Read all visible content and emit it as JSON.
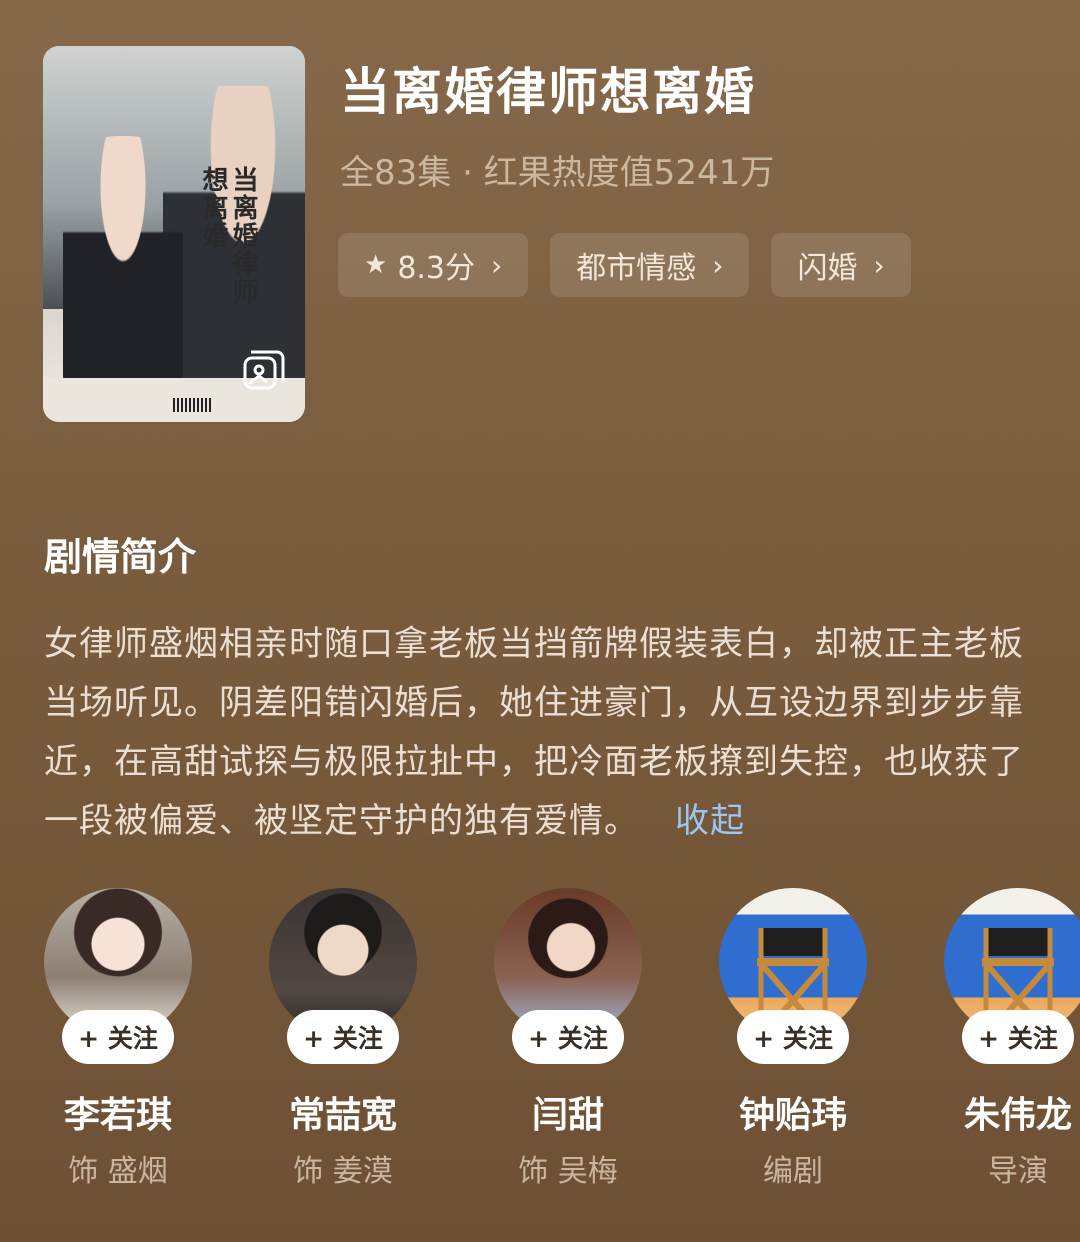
{
  "drama": {
    "title": "当离婚律师想离婚",
    "meta": "全83集 · 红果热度值5241万",
    "poster_title_art": "当离婚律师想离婚"
  },
  "chips": [
    {
      "label": "8.3分",
      "icon": "star-icon",
      "chevron": "›"
    },
    {
      "label": "都市情感",
      "chevron": "›"
    },
    {
      "label": "闪婚",
      "chevron": "›"
    }
  ],
  "synopsis": {
    "heading": "剧情简介",
    "text": "女律师盛烟相亲时随口拿老板当挡箭牌假装表白，却被正主老板当场听见。阴差阳错闪婚后，她住进豪门，从互设边界到步步靠近，在高甜试探与极限拉扯中，把冷面老板撩到失控，也收获了一段被偏爱、被坚定守护的独有爱情。",
    "collapse_label": "收起"
  },
  "cast": [
    {
      "name": "李若琪",
      "role": "饰 盛烟",
      "follow": "+ 关注",
      "avatar": "woman-avatar"
    },
    {
      "name": "常喆宽",
      "role": "饰 姜漠",
      "follow": "+ 关注",
      "avatar": "man-avatar"
    },
    {
      "name": "闫甜",
      "role": "饰 吴梅",
      "follow": "+ 关注",
      "avatar": "woman-avatar"
    },
    {
      "name": "钟贻玮",
      "role": "编剧",
      "follow": "+ 关注",
      "avatar": "director-chair-avatar"
    },
    {
      "name": "朱伟龙",
      "role": "导演",
      "follow": "+ 关注",
      "avatar": "director-chair-avatar"
    }
  ],
  "colors": {
    "background": "#7a5c3e",
    "accent_link": "#9cc6f2",
    "muted_text": "#cbb8a1"
  }
}
